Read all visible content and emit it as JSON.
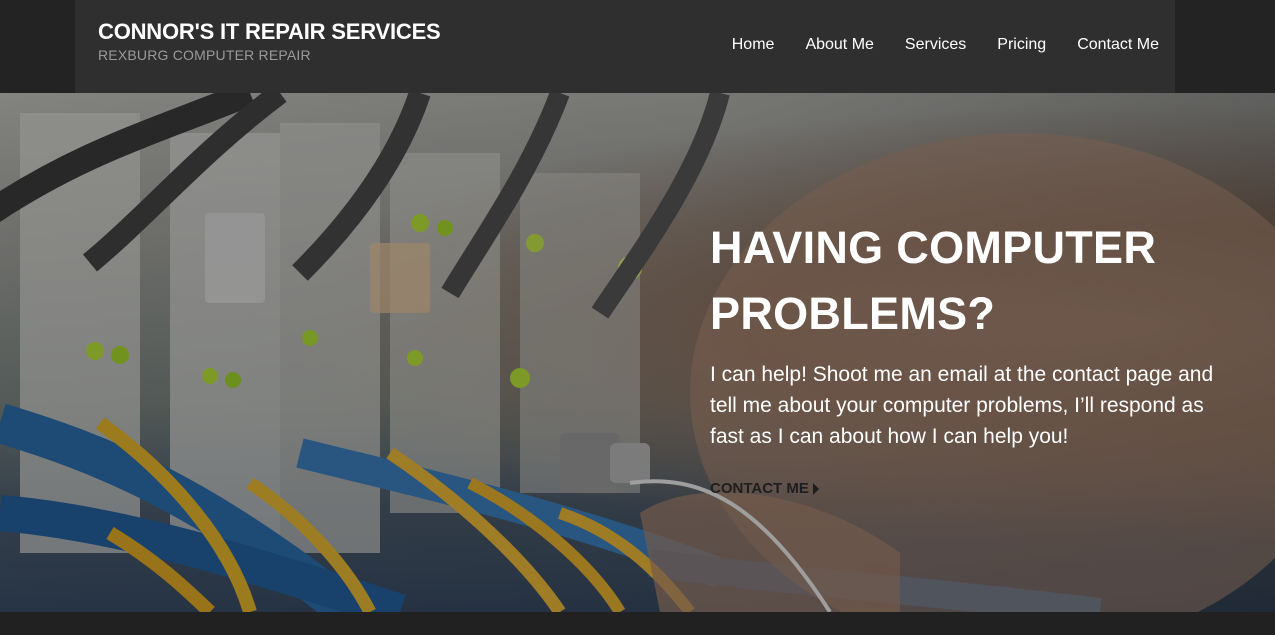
{
  "header": {
    "site_title": "CONNOR'S IT REPAIR SERVICES",
    "tagline": "REXBURG COMPUTER REPAIR"
  },
  "nav": {
    "items": [
      {
        "label": "Home"
      },
      {
        "label": "About Me"
      },
      {
        "label": "Services"
      },
      {
        "label": "Pricing"
      },
      {
        "label": "Contact Me"
      }
    ]
  },
  "hero": {
    "title": "HAVING COMPUTER PROBLEMS?",
    "text": "I can help! Shoot me an email at the contact page and tell me about your computer problems, I’ll respond as fast as I can about how I can help you!",
    "cta_label": "CONTACT ME",
    "cta_icon": "triangle-right-icon"
  },
  "colors": {
    "header_bg": "#2f2f2f",
    "page_bg": "#212121",
    "hero_text": "#ffffff"
  }
}
